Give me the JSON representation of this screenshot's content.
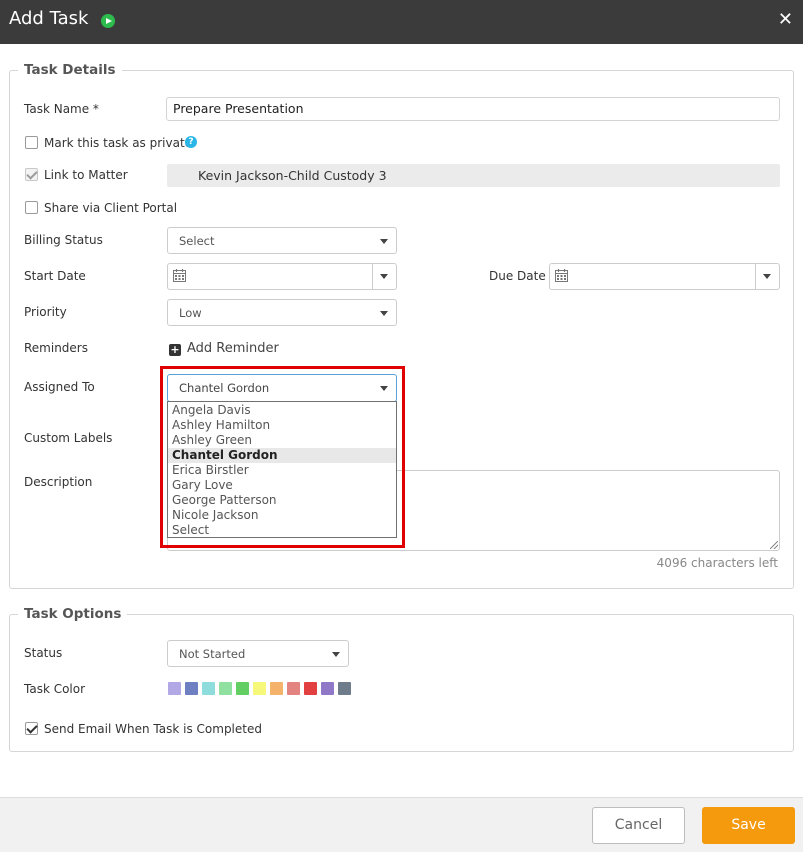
{
  "window": {
    "title": "Add Task",
    "close_glyph": "✕"
  },
  "task_details": {
    "legend": "Task Details",
    "task_name_label": "Task Name *",
    "task_name_value": "Prepare Presentation",
    "private_label": "Mark this task as private",
    "private_checked": false,
    "help_glyph": "?",
    "link_matter_label": "Link to Matter",
    "link_matter_checked": true,
    "matter_value": "Kevin Jackson-Child Custody 3",
    "share_portal_label": "Share via Client Portal",
    "share_portal_checked": false,
    "billing_status_label": "Billing Status",
    "billing_status_value": "Select",
    "start_date_label": "Start Date",
    "start_date_value": "",
    "due_date_label": "Due Date",
    "due_date_value": "",
    "priority_label": "Priority",
    "priority_value": "Low",
    "reminders_label": "Reminders",
    "add_reminder_label": "Add Reminder",
    "assigned_to_label": "Assigned To",
    "assigned_to_value": "Chantel Gordon",
    "assigned_to_options": [
      "Angela Davis",
      "Ashley Hamilton",
      "Ashley Green",
      "Chantel Gordon",
      "Erica Birstler",
      "Gary Love",
      "George Patterson",
      "Nicole Jackson",
      "Select"
    ],
    "custom_labels_label": "Custom Labels",
    "description_label": "Description",
    "description_value": "",
    "chars_left": "4096 characters left"
  },
  "task_options": {
    "legend": "Task Options",
    "status_label": "Status",
    "status_value": "Not Started",
    "task_color_label": "Task Color",
    "colors": [
      "#b3a8e6",
      "#6f80c2",
      "#8fdcdc",
      "#90e0a0",
      "#63cf63",
      "#f6f87a",
      "#f4b26a",
      "#e48480",
      "#e24040",
      "#9078c6",
      "#6e7c8c"
    ],
    "send_email_label": "Send Email When Task is Completed",
    "send_email_checked": true
  },
  "footer": {
    "cancel_label": "Cancel",
    "save_label": "Save"
  },
  "colors": {
    "highlight": "#e00000",
    "save_button": "#f59a0c",
    "play_icon": "#2dbb4e",
    "help_icon": "#29b6e6"
  }
}
